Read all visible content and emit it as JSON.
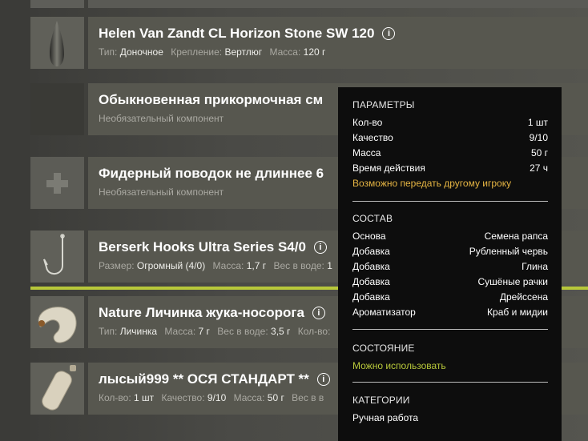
{
  "items": [
    {
      "title": "Helen Van Zandt CL Horizon Stone SW 120",
      "has_info": true,
      "props": [
        {
          "key": "Тип:",
          "value": "Доночное"
        },
        {
          "key": "Крепление:",
          "value": "Вертлюг"
        },
        {
          "key": "Масса:",
          "value": "120 г"
        }
      ],
      "icon": "sinker-icon"
    },
    {
      "title": "Обыкновенная прикормочная см",
      "note": "Необязательный компонент",
      "icon": "empty-slot"
    },
    {
      "title": "Фидерный поводок не длиннее 6",
      "note": "Необязательный компонент",
      "icon": "plus-icon"
    },
    {
      "title": "Berserk Hooks Ultra Series S4/0",
      "has_info": true,
      "props": [
        {
          "key": "Размер:",
          "value": "Огромный (4/0)"
        },
        {
          "key": "Масса:",
          "value": "1,7 г"
        },
        {
          "key": "Вес в воде:",
          "value": "1"
        }
      ],
      "icon": "hook-icon"
    },
    {
      "title": "Nature Личинка жука-носорога",
      "has_info": true,
      "props": [
        {
          "key": "Тип:",
          "value": "Личинка"
        },
        {
          "key": "Масса:",
          "value": "7 г"
        },
        {
          "key": "Вес в воде:",
          "value": "3,5 г"
        },
        {
          "key": "Кол-во:",
          "value": ""
        }
      ],
      "icon": "larva-icon"
    },
    {
      "title": "лысый999 ** ОСЯ СТАНДАРТ **",
      "has_info": true,
      "props": [
        {
          "key": "Кол-во:",
          "value": "1 шт"
        },
        {
          "key": "Качество:",
          "value": "9/10"
        },
        {
          "key": "Масса:",
          "value": "50 г"
        },
        {
          "key": "Вес в в",
          "value": ""
        }
      ],
      "icon": "bait-ball-icon"
    }
  ],
  "info_glyph": "i",
  "tooltip": {
    "params_title": "ПАРАМЕТРЫ",
    "params": [
      {
        "label": "Кол-во",
        "value": "1 шт"
      },
      {
        "label": "Качество",
        "value": "9/10"
      },
      {
        "label": "Масса",
        "value": "50 г"
      },
      {
        "label": "Время действия",
        "value": "27 ч"
      }
    ],
    "transfer_note": "Возможно передать другому игроку",
    "composition_title": "СОСТАВ",
    "composition": [
      {
        "label": "Основа",
        "value": "Семена рапса"
      },
      {
        "label": "Добавка",
        "value": "Рубленный червь"
      },
      {
        "label": "Добавка",
        "value": "Глина"
      },
      {
        "label": "Добавка",
        "value": "Сушёные рачки"
      },
      {
        "label": "Добавка",
        "value": "Дрейссена"
      },
      {
        "label": "Ароматизатор",
        "value": "Краб и мидии"
      }
    ],
    "state_title": "СОСТОЯНИЕ",
    "state_value": "Можно использовать",
    "categories_title": "КАТЕГОРИИ",
    "categories_value": "Ручная работа"
  },
  "colors": {
    "accent_yellow": "#e6b543",
    "accent_green": "#b8c83a",
    "selection_line": "#b8c83a"
  }
}
